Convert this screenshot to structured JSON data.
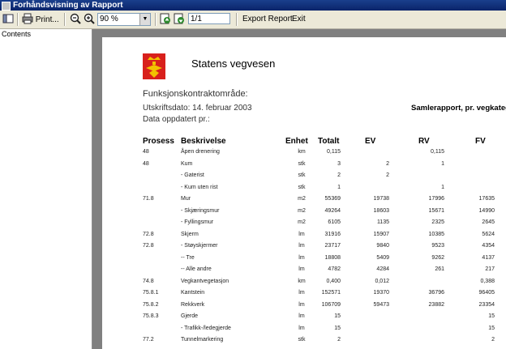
{
  "window": {
    "title": "Forhåndsvisning av Rapport"
  },
  "toolbar": {
    "print_label": "Print...",
    "zoom_value": "90 %",
    "page_value": "1/1",
    "export_label": "Export Report",
    "exit_label": "Exit"
  },
  "sidebar": {
    "header": "Contents"
  },
  "report": {
    "org_name": "Statens vegvesen",
    "subtitle": "Funksjonskontraktområde:",
    "print_date": "Utskriftsdato: 14. februar 2003",
    "updated": "Data oppdatert pr.:",
    "title": "Samlerapport, pr. vegkategori (m",
    "columns": [
      "Prosess",
      "Beskrivelse",
      "Enhet",
      "Totalt",
      "EV",
      "RV",
      "FV"
    ],
    "rows": [
      {
        "prosess": "48",
        "beskrivelse": "Åpen drenering",
        "enhet": "km",
        "totalt": "0,115",
        "ev": "",
        "rv": "0,115",
        "fv": ""
      },
      {
        "prosess": "48",
        "beskrivelse": "Kum",
        "enhet": "stk",
        "totalt": "3",
        "ev": "2",
        "rv": "1",
        "fv": ""
      },
      {
        "prosess": "",
        "beskrivelse": "- Gaterist",
        "enhet": "stk",
        "totalt": "2",
        "ev": "2",
        "rv": "",
        "fv": ""
      },
      {
        "prosess": "",
        "beskrivelse": "- Kum uten rist",
        "enhet": "stk",
        "totalt": "1",
        "ev": "",
        "rv": "1",
        "fv": ""
      },
      {
        "prosess": "71.8",
        "beskrivelse": "Mur",
        "enhet": "m2",
        "totalt": "55369",
        "ev": "19738",
        "rv": "17996",
        "fv": "17635"
      },
      {
        "prosess": "",
        "beskrivelse": "- Skjæringsmur",
        "enhet": "m2",
        "totalt": "49264",
        "ev": "18603",
        "rv": "15671",
        "fv": "14990"
      },
      {
        "prosess": "",
        "beskrivelse": "- Fyllingsmur",
        "enhet": "m2",
        "totalt": "6105",
        "ev": "1135",
        "rv": "2325",
        "fv": "2645"
      },
      {
        "prosess": "72.8",
        "beskrivelse": "Skjerm",
        "enhet": "lm",
        "totalt": "31916",
        "ev": "15907",
        "rv": "10385",
        "fv": "5624"
      },
      {
        "prosess": "72.8",
        "beskrivelse": "- Støyskjermer",
        "enhet": "lm",
        "totalt": "23717",
        "ev": "9840",
        "rv": "9523",
        "fv": "4354"
      },
      {
        "prosess": "",
        "beskrivelse": "-- Tre",
        "enhet": "lm",
        "totalt": "18808",
        "ev": "5409",
        "rv": "9262",
        "fv": "4137"
      },
      {
        "prosess": "",
        "beskrivelse": "-- Alle andre",
        "enhet": "lm",
        "totalt": "4782",
        "ev": "4284",
        "rv": "261",
        "fv": "217"
      },
      {
        "prosess": "74.8",
        "beskrivelse": "Vegkantvegetasjon",
        "enhet": "km",
        "totalt": "0,400",
        "ev": "0,012",
        "rv": "",
        "fv": "0,388"
      },
      {
        "prosess": "75.8.1",
        "beskrivelse": "Kantstein",
        "enhet": "lm",
        "totalt": "152571",
        "ev": "19370",
        "rv": "36796",
        "fv": "96405"
      },
      {
        "prosess": "75.8.2",
        "beskrivelse": "Rekkverk",
        "enhet": "lm",
        "totalt": "106709",
        "ev": "59473",
        "rv": "23882",
        "fv": "23354"
      },
      {
        "prosess": "75.8.3",
        "beskrivelse": "Gjerde",
        "enhet": "lm",
        "totalt": "15",
        "ev": "",
        "rv": "",
        "fv": "15"
      },
      {
        "prosess": "",
        "beskrivelse": "- Trafikk-/ledegjerde",
        "enhet": "lm",
        "totalt": "15",
        "ev": "",
        "rv": "",
        "fv": "15"
      },
      {
        "prosess": "77.2",
        "beskrivelse": "Tunnelmarkering",
        "enhet": "stk",
        "totalt": "2",
        "ev": "",
        "rv": "",
        "fv": "2"
      }
    ]
  }
}
